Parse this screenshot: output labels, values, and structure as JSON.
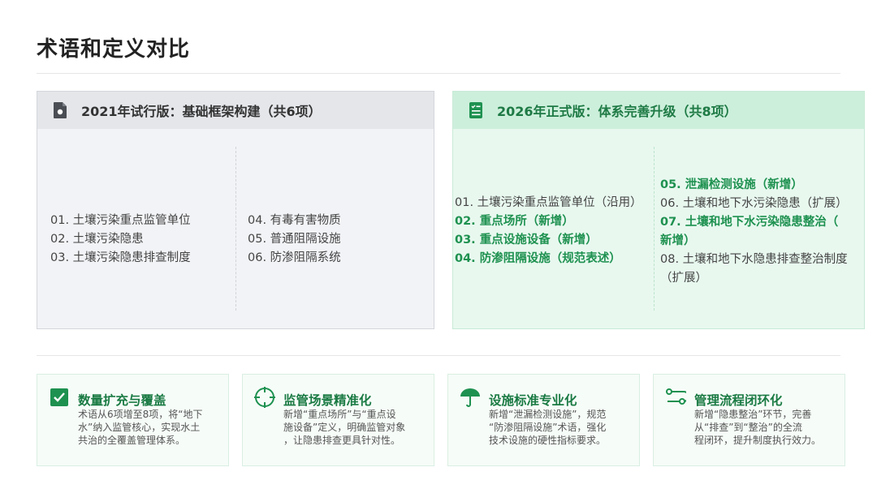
{
  "title": "术语和定义对比",
  "panels": {
    "old": {
      "heading": "2021年试行版：基础框架构建（共6项）",
      "icon": "document-icon",
      "left_items": [
        "01. 土壤污染重点监管单位",
        "02. 土壤污染隐患",
        "03. 土壤污染隐患排查制度"
      ],
      "right_items": [
        "04. 有毒有害物质",
        "05. 普通阻隔设施",
        "06. 防渗阻隔系统"
      ]
    },
    "new": {
      "heading": "2026年正式版：体系完善升级（共8项）",
      "icon": "checklist-icon",
      "left_items": [
        "01. 土壤污染重点监管单位（沿用）",
        "02. 重点场所（新增）",
        "03. 重点设施设备（新增）",
        "04. 防渗阻隔设施（规范表述）"
      ],
      "right_items": [
        "05. 泄漏检测设施（新增）",
        "06. 土壤和地下水污染隐患（扩展）",
        "07. 土壤和地下水污染隐患整治（",
        "新增）",
        "08. 土壤和地下水隐患排查整治制度",
        "（扩展）"
      ]
    }
  },
  "cards": [
    {
      "title": "数量扩充与覆盖",
      "icon": "check-square-icon",
      "desc": [
        "术语从6项增至8项，将“地下",
        "水”纳入监管核心，实现水土",
        "共治的全覆盖管理体系。"
      ]
    },
    {
      "title": "监管场景精准化",
      "icon": "crosshair-icon",
      "desc": [
        "新增“重点场所”与“重点设",
        "施设备”定义，明确监管对象",
        "，让隐患排查更具针对性。"
      ]
    },
    {
      "title": "设施标准专业化",
      "icon": "umbrella-icon",
      "desc": [
        "新增“泄漏检测设施”，规范",
        "“防渗阻隔设施”术语，强化",
        "技术设施的硬性指标要求。"
      ]
    },
    {
      "title": "管理流程闭环化",
      "icon": "flow-icon",
      "desc": [
        "新增“隐患整治”环节，完善",
        "从“排查”到“整治”的全流",
        "程闭环，提升制度执行效力。"
      ]
    }
  ],
  "colors": {
    "accent": "#1e9150",
    "accent_dark": "#1a7a43",
    "old_bg": "#f2f3f6",
    "new_bg": "#e8f8ef"
  }
}
